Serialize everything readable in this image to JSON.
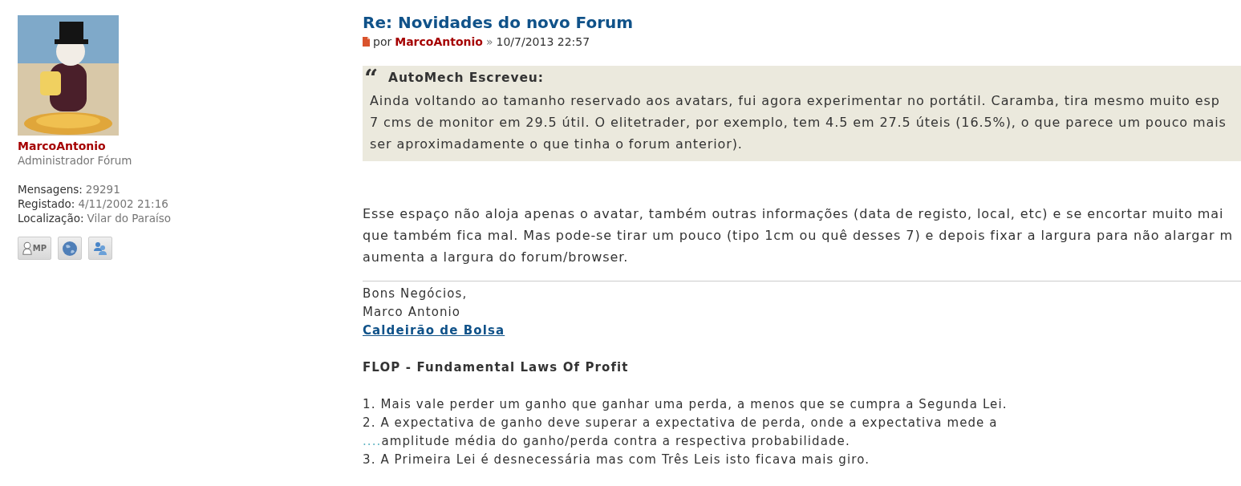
{
  "profile": {
    "username": "MarcoAntonio",
    "rank": "Administrador Fórum",
    "fields": [
      {
        "label": "Mensagens:",
        "value": "29291"
      },
      {
        "label": "Registado:",
        "value": "4/11/2002 21:16"
      },
      {
        "label": "Localização:",
        "value": "Vilar do Paraíso"
      }
    ],
    "buttons": [
      {
        "kind": "pm",
        "label": "MP"
      },
      {
        "kind": "globe"
      },
      {
        "kind": "people"
      }
    ]
  },
  "post": {
    "title": "Re: Novidades do novo Forum",
    "by_label": "por",
    "author": "MarcoAntonio",
    "separator": "»",
    "date": "10/7/2013 22:57",
    "quote": {
      "mark": "“",
      "cite": "AutoMech Escreveu:",
      "lines": [
        "Ainda voltando ao tamanho reservado aos avatars, fui agora experimentar no portátil. Caramba, tira mesmo muito esp",
        "7 cms de monitor em 29.5 útil. O elitetrader, por exemplo, tem 4.5 em 27.5 úteis (16.5%), o que parece um pouco mais",
        "ser aproximadamente o que tinha o forum anterior)."
      ]
    },
    "body_lines": [
      "Esse espaço não aloja apenas o avatar, também outras informações (data de registo, local, etc) e se encortar muito mai",
      "que também fica mal. Mas pode-se tirar um pouco (tipo 1cm ou quê desses 7) e depois fixar a largura para não alargar m",
      "aumenta a largura do forum/browser."
    ]
  },
  "signature": {
    "lines": [
      "Bons Negócios,",
      "Marco Antonio"
    ],
    "link": "Caldeirão de Bolsa",
    "heading": "FLOP - Fundamental Laws Of Profit",
    "laws": [
      {
        "kind": "line",
        "text": "1. Mais vale perder um ganho que ganhar uma perda, a menos que se cumpra a Segunda Lei."
      },
      {
        "kind": "line",
        "text": "2. A expectativa de ganho deve superar a expectativa de perda, onde a expectativa mede a"
      },
      {
        "kind": "indented",
        "filler": "....",
        "text": "amplitude média do ganho/perda contra a respectiva probabilidade."
      },
      {
        "kind": "line",
        "text": "3. A Primeira Lei é desnecessária mas com Três Leis isto ficava mais giro."
      }
    ]
  }
}
